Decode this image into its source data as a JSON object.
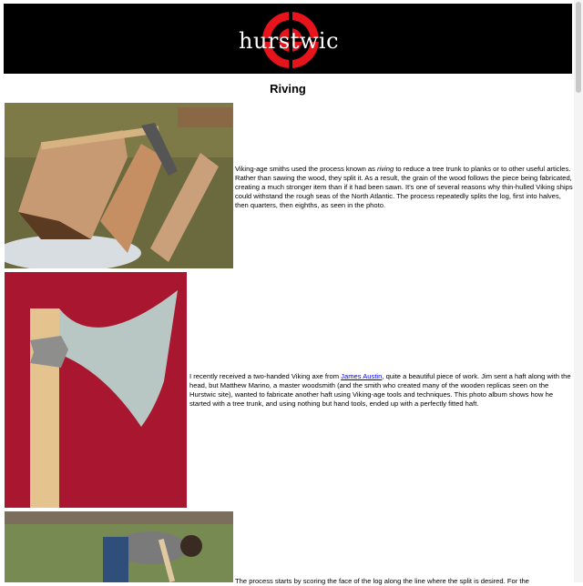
{
  "site": {
    "logo_text": "hurstwic"
  },
  "page": {
    "title": "Riving"
  },
  "sections": [
    {
      "image": "split-log-photo",
      "text_parts": [
        "Viking-age smiths used the process known as ",
        "riving",
        " to reduce a tree trunk to planks or to other useful articles. Rather than sawing the wood, they split it. As a result, the grain of the wood follows the piece being fabricated, creating a much stronger item than if it had been sawn. It's one of several reasons why thin-hulled Viking ships could withstand the rough seas of the North Atlantic. The process repeatedly splits the log, first into halves, then quarters, then eighths, as seen in the photo."
      ]
    },
    {
      "image": "viking-axe-photo",
      "text_parts": [
        "I recently received a two-handed Viking axe from ",
        "James Austin",
        ", quite a beautiful piece of work. Jim sent a haft along with the head, but Matthew Marino, a master woodsmith (and the smith who created many of the wooden replicas seen on the Hurstwic site), wanted to fabricate another haft using Viking-age tools and techniques. This photo album shows how he started with a tree trunk, and using nothing but hand tools, ended up with a perfectly fitted haft."
      ]
    },
    {
      "image": "woodsmith-scoring-log-photo",
      "text_parts": [
        "The process starts by scoring the face of the log along the line where the split is desired. For the"
      ]
    }
  ],
  "colors": {
    "banner_bg": "#000000",
    "logo_red": "#e8141c",
    "link": "#0000ee"
  }
}
